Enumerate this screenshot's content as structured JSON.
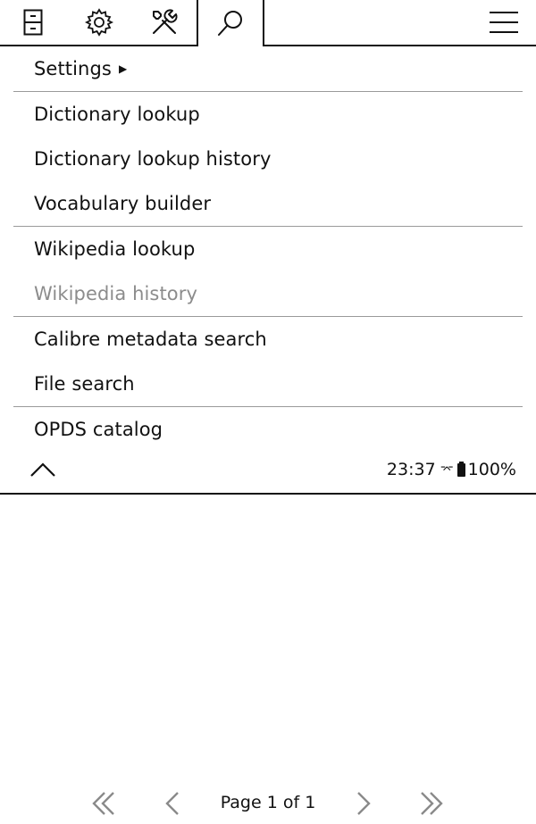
{
  "tabs": [
    {
      "icon": "file-cabinet-icon"
    },
    {
      "icon": "gear-icon"
    },
    {
      "icon": "tools-icon"
    },
    {
      "icon": "search-icon",
      "active": true
    },
    {
      "icon": "hamburger-menu-icon"
    }
  ],
  "menu": {
    "settings": "Settings",
    "dictionary_lookup": "Dictionary lookup",
    "dictionary_lookup_history": "Dictionary lookup history",
    "vocabulary_builder": "Vocabulary builder",
    "wikipedia_lookup": "Wikipedia lookup",
    "wikipedia_history": "Wikipedia history",
    "calibre_metadata_search": "Calibre metadata search",
    "file_search": "File search",
    "opds_catalog": "OPDS catalog"
  },
  "status": {
    "time": "23:37",
    "battery": "100%"
  },
  "pager": {
    "label": "Page 1 of 1"
  },
  "colors": {
    "text": "#111111",
    "disabled": "#8c8c8c",
    "separator": "#9a9a9a"
  }
}
